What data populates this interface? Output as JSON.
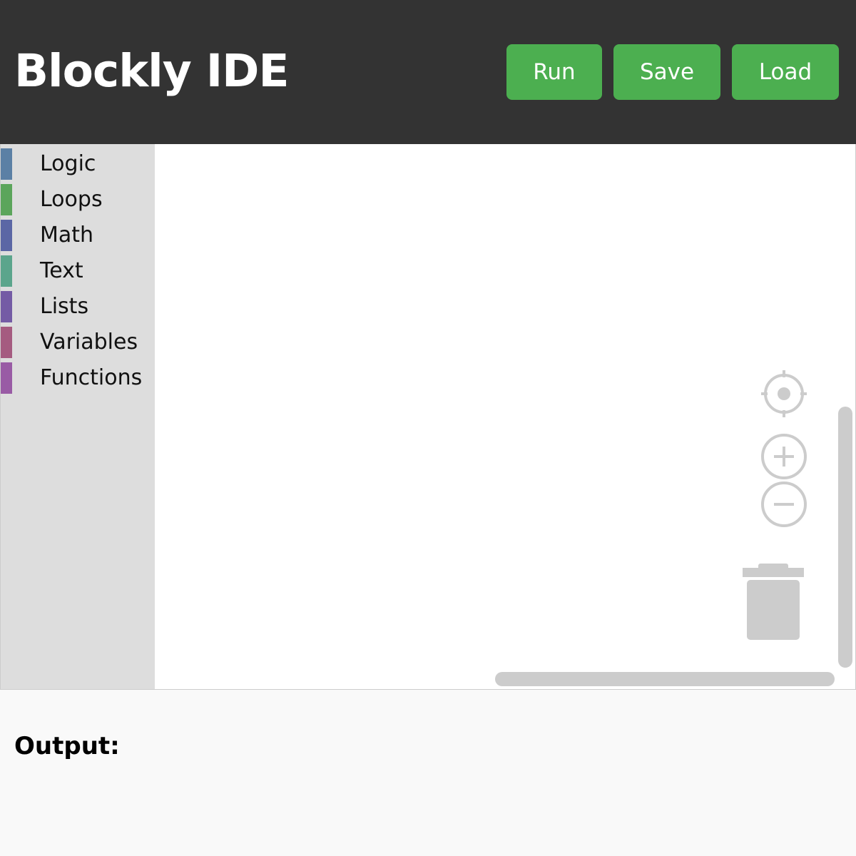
{
  "header": {
    "title": "Blockly IDE",
    "buttons": {
      "run": "Run",
      "save": "Save",
      "load": "Load"
    }
  },
  "toolbox": {
    "categories": [
      {
        "label": "Logic",
        "color": "#5b80a5"
      },
      {
        "label": "Loops",
        "color": "#5ba55b"
      },
      {
        "label": "Math",
        "color": "#5b67a5"
      },
      {
        "label": "Text",
        "color": "#5ba58c"
      },
      {
        "label": "Lists",
        "color": "#745ba5"
      },
      {
        "label": "Variables",
        "color": "#a55b80"
      },
      {
        "label": "Functions",
        "color": "#995ba5"
      }
    ]
  },
  "workspace_controls": {
    "icons": [
      "recenter-icon",
      "zoom-in-icon",
      "zoom-out-icon",
      "trash-icon"
    ]
  },
  "output": {
    "label": "Output:",
    "content": ""
  },
  "colors": {
    "header_bg": "#333333",
    "accent": "#4caf50",
    "toolbox_bg": "#dddddd",
    "control_gray": "#cccccc"
  }
}
